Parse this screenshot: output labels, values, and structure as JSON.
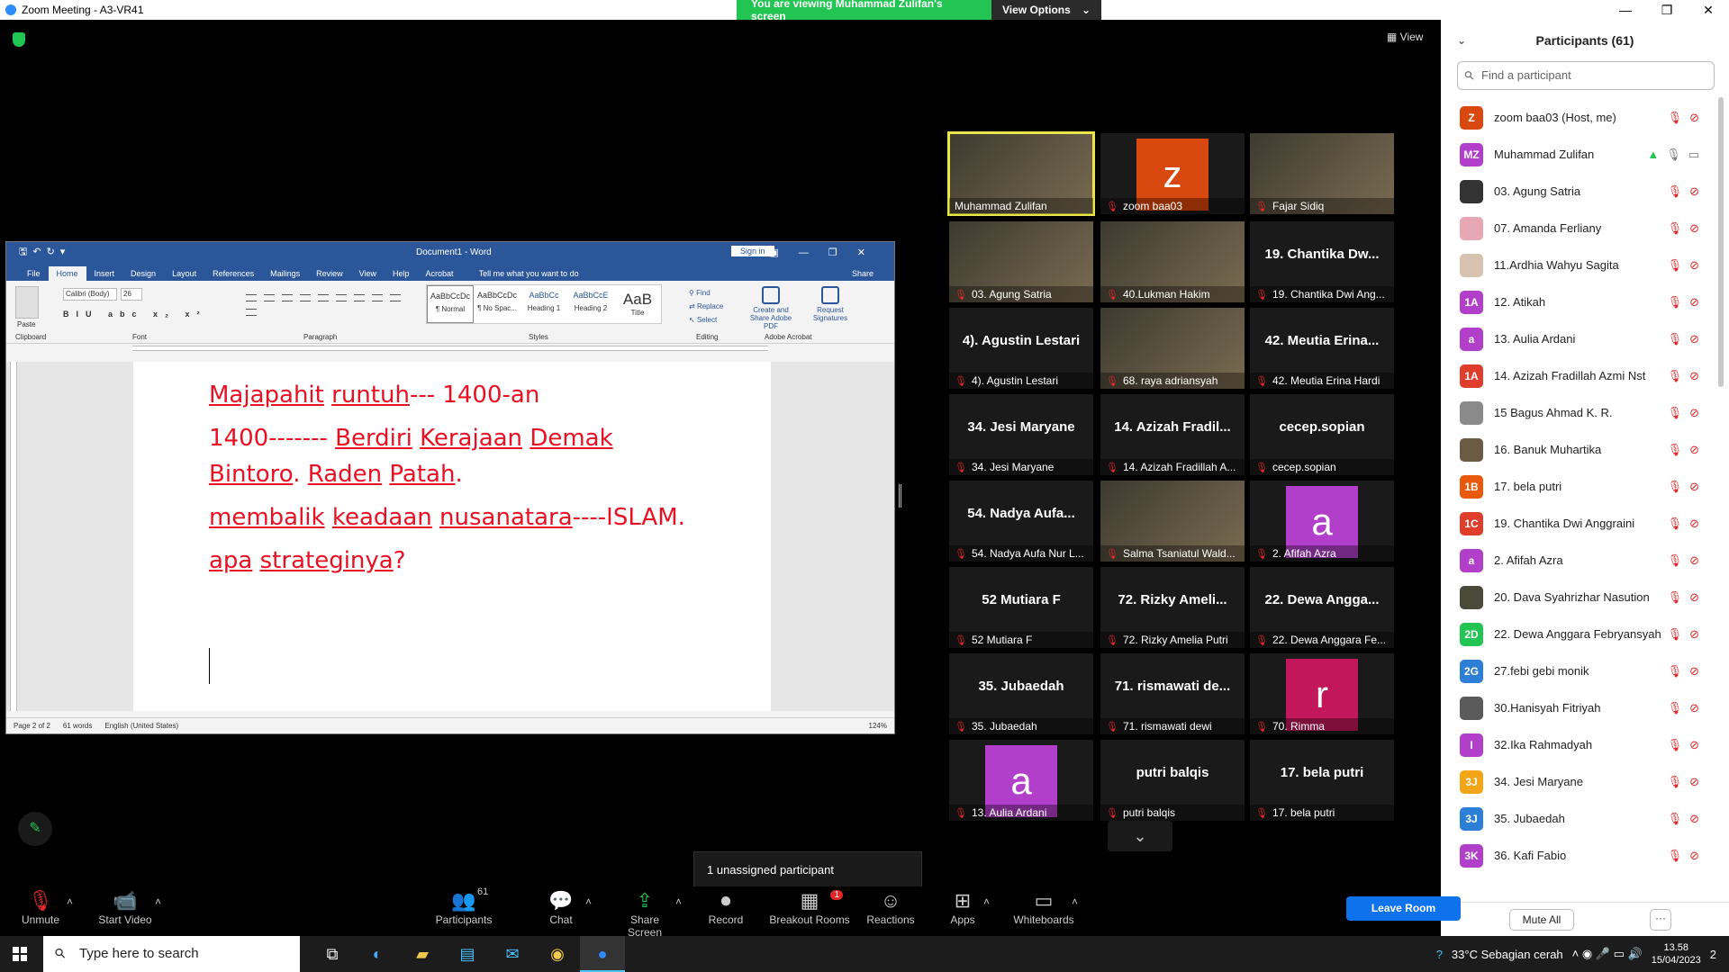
{
  "window": {
    "title": "Zoom Meeting - A3-VR41"
  },
  "banner": {
    "message": "You are viewing Muhammad Zulifan's screen",
    "options": "View Options"
  },
  "view_label": "View",
  "word": {
    "doc_title": "Document1  -  Word",
    "sign_in": "Sign in",
    "tabs": [
      "File",
      "Home",
      "Insert",
      "Design",
      "Layout",
      "References",
      "Mailings",
      "Review",
      "View",
      "Help",
      "Acrobat"
    ],
    "tell_me": "Tell me what you want to do",
    "share": "Share",
    "font_name": "Calibri (Body)",
    "font_size": "26",
    "styles": [
      {
        "preview": "AaBbCcDc",
        "label": "¶ Normal"
      },
      {
        "preview": "AaBbCcDc",
        "label": "¶ No Spac..."
      },
      {
        "preview": "AaBbCc",
        "label": "Heading 1"
      },
      {
        "preview": "AaBbCcE",
        "label": "Heading 2"
      },
      {
        "preview": "AaB",
        "label": "Title"
      }
    ],
    "editing": [
      "Find",
      "Replace",
      "Select"
    ],
    "adobe": [
      "Create and Share Adobe PDF",
      "Request Signatures"
    ],
    "groups": [
      "Clipboard",
      "Font",
      "Paragraph",
      "Styles",
      "Editing",
      "Adobe Acrobat"
    ],
    "paste": "Paste",
    "doc_lines": {
      "l1a": "Majapahit",
      "l1b": "runtuh",
      "l1c": "--- 1400-an",
      "l2a": "1400------- ",
      "l2b": "Berdiri",
      "l2c": " ",
      "l2d": "Kerajaan",
      "l2e": " ",
      "l2f": "Demak",
      "l3a": "Bintoro",
      "l3b": ". ",
      "l3c": "Raden",
      "l3d": " ",
      "l3e": "Patah",
      "l3f": ".",
      "l4a": "membalik",
      "l4b": " ",
      "l4c": "keadaan",
      "l4d": " ",
      "l4e": "nusanatara",
      "l4f": "----ISLAM.",
      "l5a": "apa",
      "l5b": " ",
      "l5c": "strateginya",
      "l5d": "?"
    },
    "status": {
      "page": "Page 2 of 2",
      "words": "61 words",
      "lang": "English (United States)",
      "zoom": "124%"
    }
  },
  "gallery": [
    {
      "name": "Muhammad Zulifan",
      "type": "video",
      "active": true,
      "muted": false
    },
    {
      "name": "zoom baa03",
      "type": "avatar",
      "letter": "z",
      "color": "#d9480f",
      "muted": true
    },
    {
      "name": "Fajar Sidiq",
      "type": "video",
      "muted": true
    },
    {
      "name": "03. Agung Satria",
      "type": "video",
      "muted": true
    },
    {
      "name": "40.Lukman Hakim",
      "type": "video",
      "muted": true
    },
    {
      "name": "19. Chantika Dwi Ang...",
      "big": "19. Chantika Dw...",
      "type": "text",
      "muted": true
    },
    {
      "name": "4). Agustin Lestari",
      "big": "4). Agustin Lestari",
      "type": "text",
      "muted": true
    },
    {
      "name": "68. raya adriansyah",
      "type": "video",
      "muted": true
    },
    {
      "name": "42. Meutia Erina Hardi",
      "big": "42. Meutia Erina...",
      "type": "text",
      "muted": true
    },
    {
      "name": "34. Jesi Maryane",
      "big": "34. Jesi Maryane",
      "type": "text",
      "muted": true
    },
    {
      "name": "14. Azizah Fradillah A...",
      "big": "14. Azizah Fradil...",
      "type": "text",
      "muted": true
    },
    {
      "name": "cecep.sopian",
      "big": "cecep.sopian",
      "type": "text",
      "muted": true
    },
    {
      "name": "54. Nadya Aufa Nur L...",
      "big": "54. Nadya Aufa...",
      "type": "text",
      "muted": true
    },
    {
      "name": "Salma Tsaniatul Wald...",
      "type": "video",
      "muted": true
    },
    {
      "name": "2. Afifah Azra",
      "type": "avatar",
      "letter": "a",
      "color": "#b13fc9",
      "muted": true
    },
    {
      "name": "52 Mutiara F",
      "big": "52 Mutiara F",
      "type": "text",
      "muted": true
    },
    {
      "name": "72. Rizky Amelia Putri",
      "big": "72. Rizky Ameli...",
      "type": "text",
      "muted": true
    },
    {
      "name": "22. Dewa Anggara Fe...",
      "big": "22. Dewa Angga...",
      "type": "text",
      "muted": true
    },
    {
      "name": "35. Jubaedah",
      "big": "35. Jubaedah",
      "type": "text",
      "muted": true
    },
    {
      "name": "71. rismawati dewi",
      "big": "71. rismawati de...",
      "type": "text",
      "muted": true
    },
    {
      "name": "70. Rimma",
      "type": "avatar",
      "letter": "r",
      "color": "#c2185b",
      "muted": true
    },
    {
      "name": "13. Aulia Ardani",
      "type": "avatar",
      "letter": "a",
      "color": "#b13fc9",
      "muted": true
    },
    {
      "name": "putri balqis",
      "big": "putri balqis",
      "type": "text",
      "muted": true
    },
    {
      "name": "17. bela putri",
      "big": "17. bela putri",
      "type": "text",
      "muted": true
    }
  ],
  "unassigned": "1 unassigned participant",
  "toolbar": {
    "unmute": "Unmute",
    "start_video": "Start Video",
    "participants": "Participants",
    "participants_count": "61",
    "chat": "Chat",
    "share_screen": "Share Screen",
    "record": "Record",
    "breakout": "Breakout Rooms",
    "breakout_badge": "1",
    "reactions": "Reactions",
    "apps": "Apps",
    "whiteboards": "Whiteboards",
    "leave": "Leave Room"
  },
  "panel": {
    "title": "Participants (61)",
    "search_placeholder": "Find a participant",
    "mute_all": "Mute All",
    "more": "···",
    "participants": [
      {
        "initials": "Z",
        "name": "zoom baa03 (Host, me)",
        "color": "#d9480f"
      },
      {
        "initials": "MZ",
        "name": "Muhammad Zulifan",
        "color": "#b13fc9",
        "sharing": true
      },
      {
        "initials": "",
        "name": "03. Agung Satria",
        "color": "#333333"
      },
      {
        "initials": "",
        "name": "07. Amanda Ferliany",
        "color": "#e8a7b4"
      },
      {
        "initials": "",
        "name": "11.Ardhia Wahyu Sagita",
        "color": "#d7c3b0"
      },
      {
        "initials": "1A",
        "name": "12. Atikah",
        "color": "#b13fc9"
      },
      {
        "initials": "a",
        "name": "13. Aulia Ardani",
        "color": "#b13fc9"
      },
      {
        "initials": "1A",
        "name": "14. Azizah Fradillah Azmi Nst",
        "color": "#e03e2d"
      },
      {
        "initials": "",
        "name": "15 Bagus Ahmad K. R.",
        "color": "#8a8a8a"
      },
      {
        "initials": "",
        "name": "16. Banuk Muhartika",
        "color": "#6b5b45"
      },
      {
        "initials": "1B",
        "name": "17. bela putri",
        "color": "#e8590c"
      },
      {
        "initials": "1C",
        "name": "19. Chantika Dwi Anggraini",
        "color": "#e03e2d"
      },
      {
        "initials": "a",
        "name": "2. Afifah Azra",
        "color": "#b13fc9"
      },
      {
        "initials": "",
        "name": "20. Dava Syahrizhar Nasution",
        "color": "#4a4a3a"
      },
      {
        "initials": "2D",
        "name": "22. Dewa Anggara Febryansyah",
        "color": "#23c552"
      },
      {
        "initials": "2G",
        "name": "27.febi gebi monik",
        "color": "#2d7fd6"
      },
      {
        "initials": "",
        "name": "30.Hanisyah Fitriyah",
        "color": "#5a5a5a"
      },
      {
        "initials": "I",
        "name": "32.Ika Rahmadyah",
        "color": "#b13fc9"
      },
      {
        "initials": "3J",
        "name": "34. Jesi Maryane",
        "color": "#f2a516"
      },
      {
        "initials": "3J",
        "name": "35. Jubaedah",
        "color": "#2d7fd6"
      },
      {
        "initials": "3K",
        "name": "36. Kafi Fabio",
        "color": "#b13fc9"
      }
    ]
  },
  "taskbar": {
    "search": "Type here to search",
    "weather": "33°C  Sebagian cerah",
    "time": "13.58",
    "date": "15/04/2023",
    "notif": "2"
  }
}
